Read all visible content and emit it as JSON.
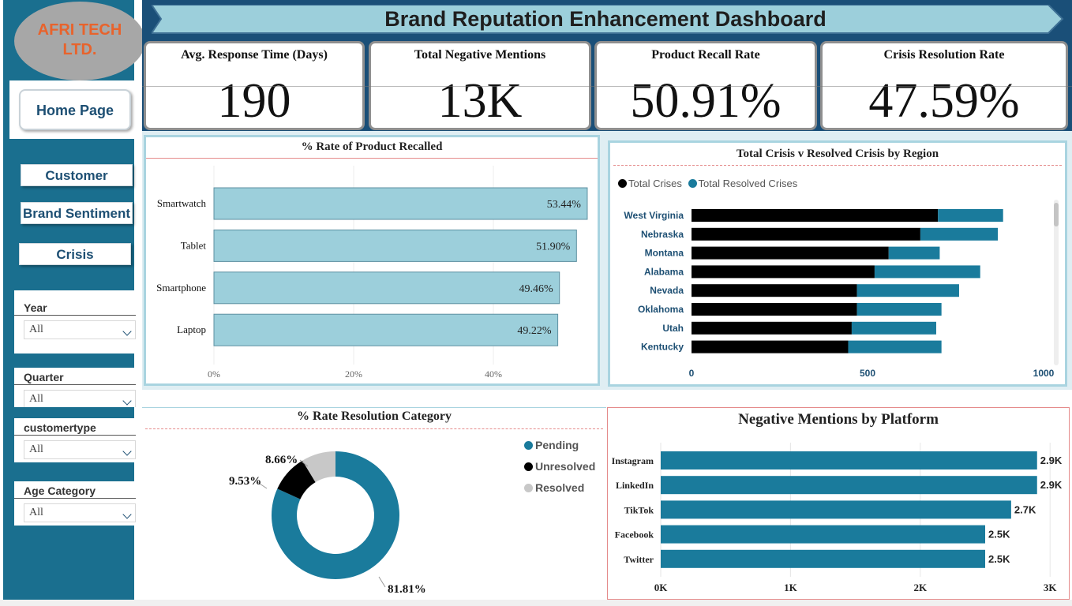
{
  "company": {
    "name_line1": "AFRI TECH",
    "name_line2": "LTD."
  },
  "nav": {
    "home": "Home Page",
    "customer": "Customer",
    "brand_sentiment": "Brand Sentiment",
    "crisis": "Crisis"
  },
  "filters": [
    {
      "label": "Year",
      "value": "All"
    },
    {
      "label": "Quarter",
      "value": "All"
    },
    {
      "label": "customertype",
      "value": "All"
    },
    {
      "label": "Age Category",
      "value": "All"
    }
  ],
  "header": {
    "title": "Brand Reputation Enhancement Dashboard"
  },
  "kpis": [
    {
      "label": "Avg. Response Time (Days)",
      "value": "190"
    },
    {
      "label": "Total Negative Mentions",
      "value": "13K"
    },
    {
      "label": "Product Recall Rate",
      "value": "50.91%"
    },
    {
      "label": "Crisis Resolution Rate",
      "value": "47.59%"
    }
  ],
  "colors": {
    "navy": "#1a4f78",
    "teal": "#1a7b9c",
    "light_blue": "#9ccfdb",
    "black": "#000000",
    "grey": "#c8c8c8",
    "logo_orange": "#e8632c"
  },
  "chart_data": [
    {
      "type": "bar",
      "orientation": "horizontal",
      "title": "% Rate of Product Recalled",
      "categories": [
        "Smartwatch",
        "Tablet",
        "Smartphone",
        "Laptop"
      ],
      "values": [
        53.44,
        51.9,
        49.46,
        49.22
      ],
      "value_labels": [
        "53.44%",
        "51.90%",
        "49.46%",
        "49.22%"
      ],
      "x_ticks": [
        "0%",
        "20%",
        "40%"
      ],
      "xlim": [
        0,
        55
      ],
      "color": "#9ccfdb"
    },
    {
      "type": "bar",
      "orientation": "horizontal",
      "stacked": true,
      "title": "Total Crisis v Resolved Crisis by Region",
      "categories": [
        "West Virginia",
        "Nebraska",
        "Montana",
        "Alabama",
        "Nevada",
        "Oklahoma",
        "Utah",
        "Kentucky"
      ],
      "series": [
        {
          "name": "Total Crises",
          "color": "#000000",
          "values": [
            700,
            650,
            560,
            520,
            470,
            470,
            455,
            445
          ]
        },
        {
          "name": "Total Resolved Crises",
          "color": "#1a7b9c",
          "values": [
            185,
            220,
            145,
            300,
            290,
            240,
            240,
            265
          ]
        }
      ],
      "x_ticks": [
        "0",
        "500",
        "1000"
      ],
      "xlim": [
        0,
        1000
      ],
      "legend": "top-left"
    },
    {
      "type": "pie",
      "donut": true,
      "title": "% Rate Resolution Category",
      "labels": [
        "Pending",
        "Unresolved",
        "Resolved"
      ],
      "values": [
        81.81,
        9.53,
        8.66
      ],
      "value_labels": [
        "81.81%",
        "9.53%",
        "8.66%"
      ],
      "colors": [
        "#1a7b9c",
        "#000000",
        "#c8c8c8"
      ],
      "legend": "right"
    },
    {
      "type": "bar",
      "orientation": "horizontal",
      "title": "Negative Mentions by Platform",
      "categories": [
        "Instagram",
        "LinkedIn",
        "TikTok",
        "Facebook",
        "Twitter"
      ],
      "values": [
        2900,
        2900,
        2700,
        2500,
        2500
      ],
      "value_labels": [
        "2.9K",
        "2.9K",
        "2.7K",
        "2.5K",
        "2.5K"
      ],
      "x_ticks": [
        "0K",
        "1K",
        "2K",
        "3K"
      ],
      "xlim": [
        0,
        3000
      ],
      "color": "#1a7b9c"
    }
  ]
}
